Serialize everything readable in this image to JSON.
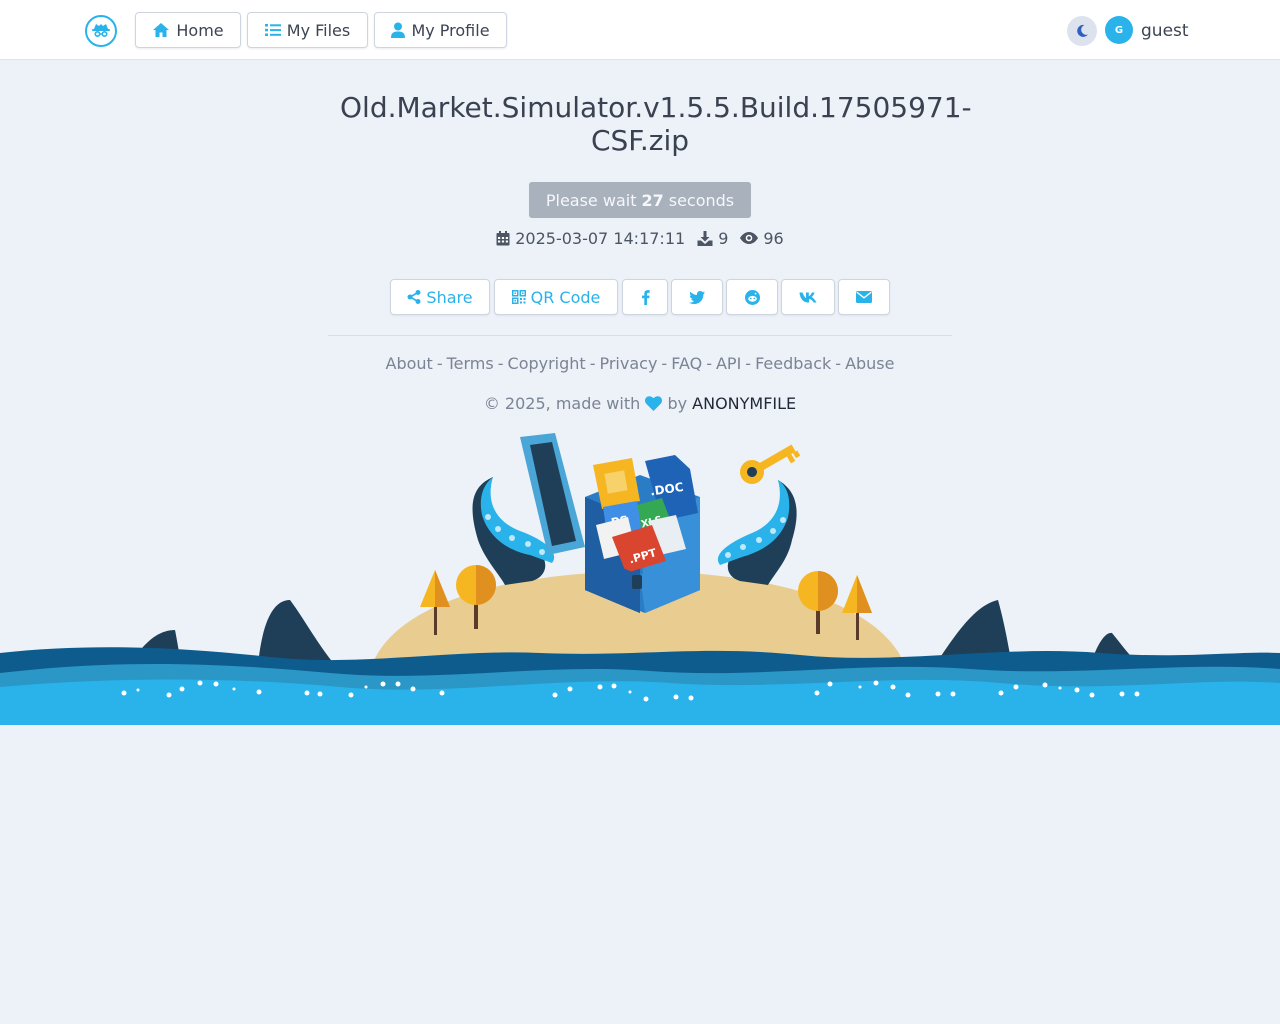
{
  "navbar": {
    "home_label": "Home",
    "files_label": "My Files",
    "profile_label": "My Profile",
    "avatar_initial": "G",
    "username": "guest"
  },
  "file": {
    "name": "Old.Market.Simulator.v1.5.5.Build.17505971-CSF.zip",
    "wait_prefix": "Please wait",
    "wait_seconds": "27",
    "wait_suffix": "seconds",
    "date": "2025-03-07 14:17:11",
    "downloads": "9",
    "views": "96"
  },
  "share": {
    "share_label": "Share",
    "qr_label": "QR Code"
  },
  "footer": {
    "links": [
      "About",
      "Terms",
      "Copyright",
      "Privacy",
      "FAQ",
      "API",
      "Feedback",
      "Abuse"
    ],
    "copyright_prefix": "© 2025, made with",
    "by": "by",
    "brand": "ANONYMFILE"
  },
  "illustration": {
    "doc_label": ".DOC",
    "xls_label": "XLS",
    "ps_label": "PS",
    "ppt_label": ".PPT"
  },
  "colors": {
    "accent": "#29b3ea",
    "page_bg": "#edf1f8",
    "wait_bg": "#a9b1bd"
  }
}
